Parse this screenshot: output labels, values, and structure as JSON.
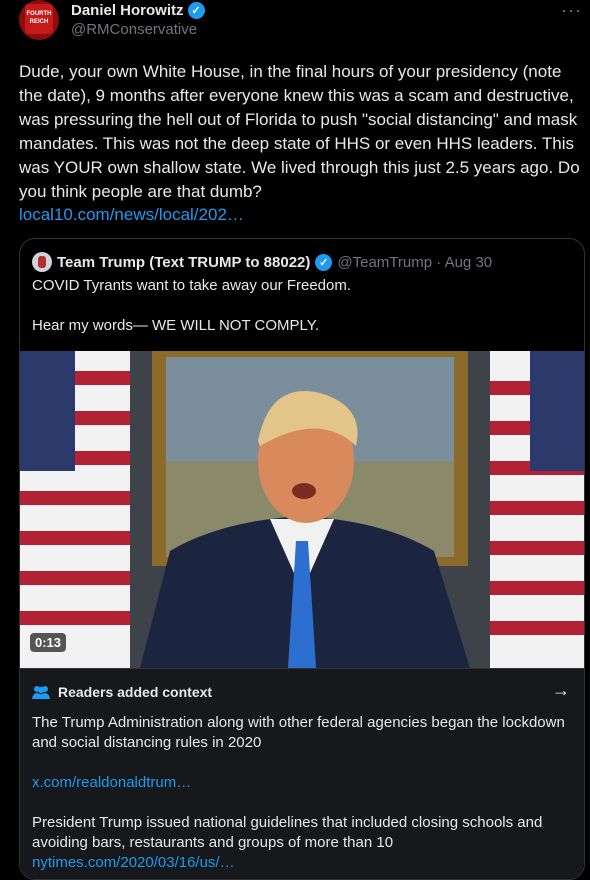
{
  "tweet": {
    "author_name": "Daniel Horowitz",
    "author_handle": "@RMConservative",
    "avatar_text": "FOURTH REICH",
    "more_label": "···",
    "text": "Dude, your own White House, in the final hours of your presidency (note the date), 9 months after everyone knew this was a scam and destructive, was pressuring the hell out of Florida to push \"social distancing\" and mask mandates. This was not the deep state of HHS or even HHS leaders. This was YOUR own shallow state. We lived through this just 2.5 years ago. Do you think people are that dumb?",
    "link": "local10.com/news/local/202…"
  },
  "quoted": {
    "author_name": "Team Trump (Text TRUMP to 88022)",
    "handle_date": "@TeamTrump · Aug 30",
    "line1": "COVID Tyrants want to take away our Freedom.",
    "line2": "Hear my words— WE WILL NOT COMPLY.",
    "video_duration": "0:13"
  },
  "community_note": {
    "title": "Readers added context",
    "para1": "The Trump Administration along with other federal agencies began the lockdown and social distancing rules in 2020",
    "link1": "x.com/realdonaldtrum…",
    "para2": "President Trump issued national guidelines that included closing schools and avoiding bars, restaurants and groups of more than 10",
    "link2": "nytimes.com/2020/03/16/us/…"
  },
  "colors": {
    "background": "#000000",
    "text": "#e7e9ea",
    "secondary": "#71767b",
    "link": "#1d9bf0",
    "verified": "#1d9bf0",
    "border": "#2f3336"
  },
  "icons": [
    "verified-badge-icon",
    "more-icon",
    "readers-icon",
    "arrow-right-icon"
  ]
}
